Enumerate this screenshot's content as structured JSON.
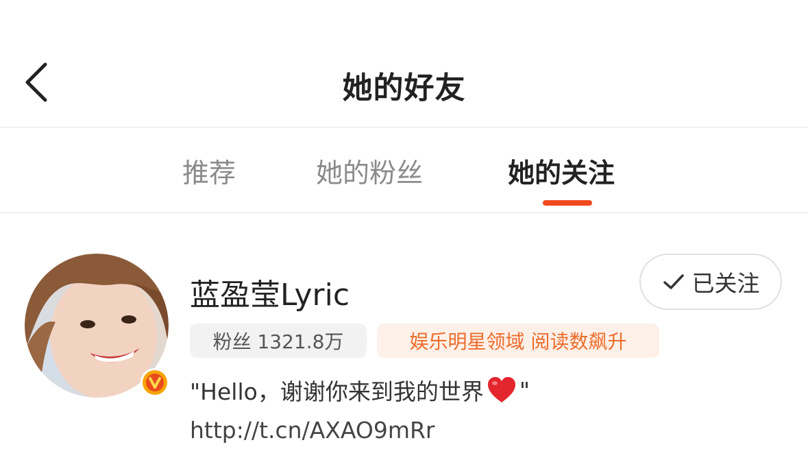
{
  "header": {
    "title": "她的好友",
    "back_icon": "chevron-left-icon"
  },
  "tabs": [
    {
      "label": "推荐",
      "active": false
    },
    {
      "label": "她的粉丝",
      "active": false
    },
    {
      "label": "她的关注",
      "active": true
    }
  ],
  "colors": {
    "accent": "#f04a1f",
    "domain_text": "#ec6c2a",
    "domain_bg": "#fdf0e8",
    "badge_orange": "#f7a400"
  },
  "user": {
    "name": "蓝盈莹Lyric",
    "verified_icon": "verified-v-icon",
    "follow_button": {
      "icon": "check-icon",
      "label": "已关注"
    },
    "followers_tag": "粉丝 1321.8万",
    "domain_tag": "娱乐明星领域 阅读数飙升",
    "bio_prefix": "\"Hello，谢谢你来到我的世界",
    "bio_suffix": "\"",
    "bio_icon": "red-heart-icon",
    "link": "http://t.cn/AXAO9mRr"
  }
}
